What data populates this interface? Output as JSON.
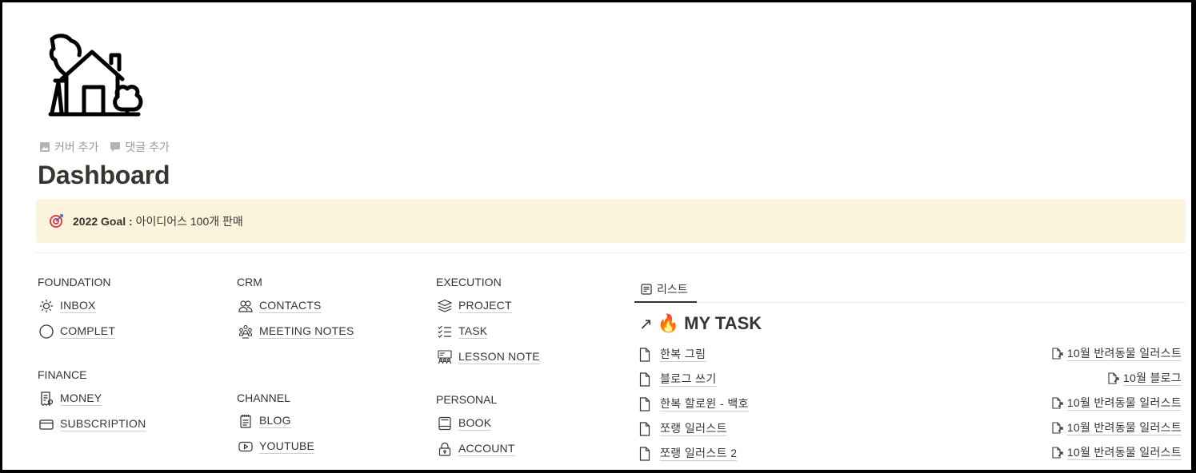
{
  "page": {
    "icon": "house-icon",
    "add_cover": "커버 추가",
    "add_comment": "댓글 추가",
    "title": "Dashboard"
  },
  "callout": {
    "icon": "target-icon",
    "bold": "2022 Goal :",
    "text": " 아이디어스 100개 판매",
    "bg_color": "#fbf3db"
  },
  "foundation": {
    "title": "FOUNDATION",
    "links": [
      {
        "label": "INBOX",
        "icon": "sun-icon"
      },
      {
        "label": "COMPLET",
        "icon": "circle-icon"
      }
    ]
  },
  "finance": {
    "title": "FINANCE",
    "links": [
      {
        "label": "MONEY",
        "icon": "receipt-icon"
      },
      {
        "label": "SUBSCRIPTION",
        "icon": "credit-card-icon"
      }
    ]
  },
  "crm": {
    "title": "CRM",
    "links": [
      {
        "label": "CONTACTS",
        "icon": "people-icon"
      },
      {
        "label": "MEETING NOTES",
        "icon": "group-icon"
      }
    ]
  },
  "channel": {
    "title": "CHANNEL",
    "links": [
      {
        "label": "BLOG",
        "icon": "notepad-icon"
      },
      {
        "label": "YOUTUBE",
        "icon": "play-icon"
      }
    ]
  },
  "execution": {
    "title": "EXECUTION",
    "links": [
      {
        "label": "PROJECT",
        "icon": "layers-icon"
      },
      {
        "label": "TASK",
        "icon": "checklist-icon"
      },
      {
        "label": "LESSON NOTE",
        "icon": "teacher-icon"
      }
    ]
  },
  "personal": {
    "title": "PERSONAL",
    "links": [
      {
        "label": "BOOK",
        "icon": "book-icon"
      },
      {
        "label": "ACCOUNT",
        "icon": "lock-icon"
      }
    ]
  },
  "database": {
    "tab_label": "리스트",
    "arrow": "↗",
    "emoji": "🔥",
    "title": "MY TASK",
    "rows": [
      {
        "name": "한복 그림",
        "relation": "10월 반려동물 일러스트"
      },
      {
        "name": "블로그 쓰기",
        "relation": "10월 블로그"
      },
      {
        "name": "한복 할로윈 - 백호",
        "relation": "10월 반려동물 일러스트"
      },
      {
        "name": "쪼랭 일러스트",
        "relation": "10월 반려동물 일러스트"
      },
      {
        "name": "쪼랭 일러스트 2",
        "relation": "10월 반려동물 일러스트"
      }
    ]
  }
}
